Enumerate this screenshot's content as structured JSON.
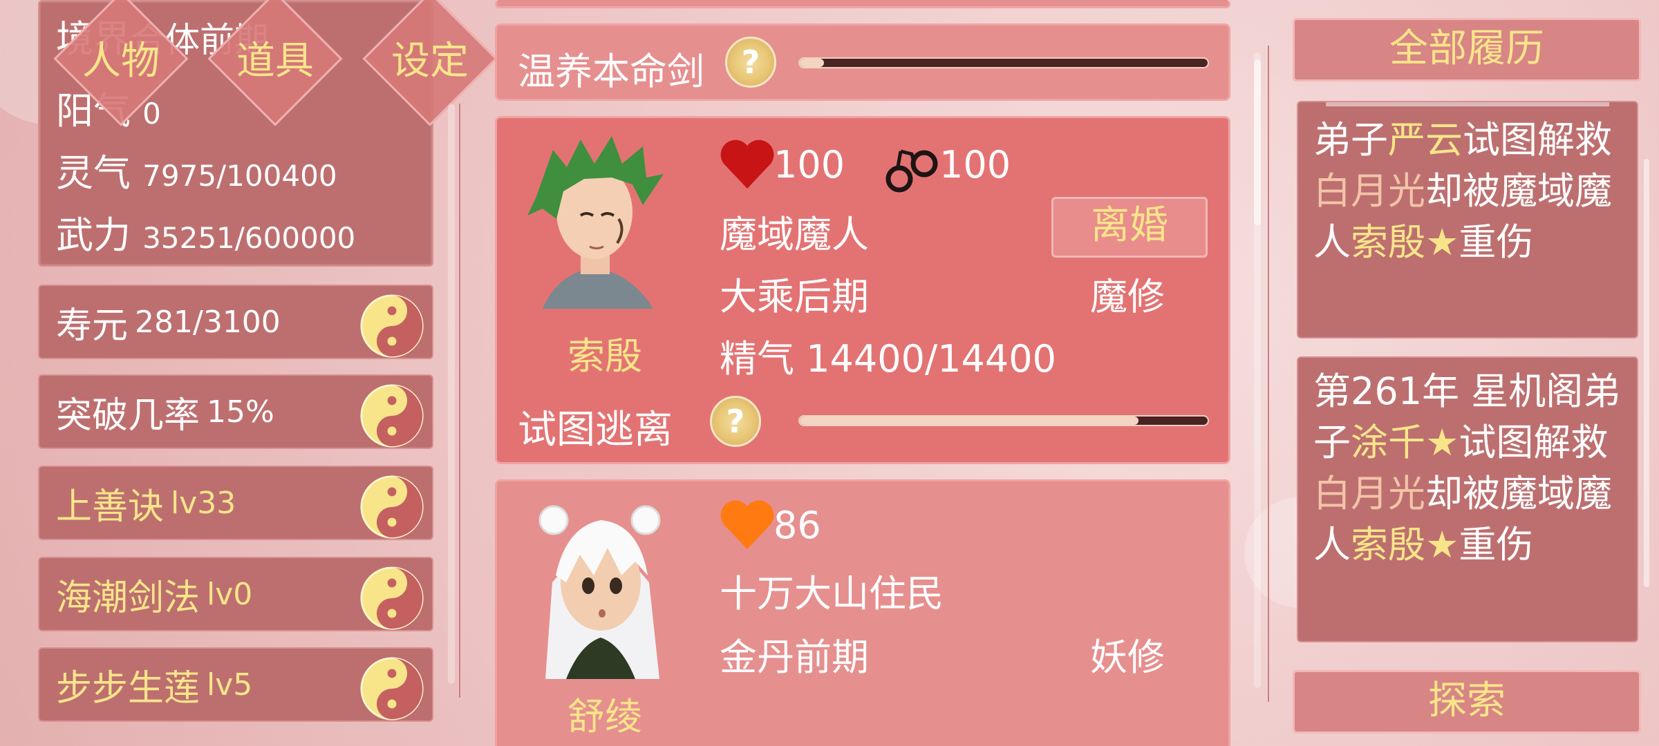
{
  "nav": {
    "tabs": [
      {
        "label": "人物"
      },
      {
        "label": "道具"
      },
      {
        "label": "设定"
      }
    ]
  },
  "stats": {
    "realm_label": "境界",
    "realm_value": "合体前期",
    "yang_label": "阳气",
    "yang_value": "0",
    "lingqi_label": "灵气",
    "lingqi_value": "7975/100400",
    "wuli_label": "武力",
    "wuli_value": "35251/600000"
  },
  "attributes": [
    {
      "label": "寿元",
      "value": "281/3100",
      "highlight": false
    },
    {
      "label": "突破几率",
      "value": "15%",
      "highlight": false
    },
    {
      "label": "上善诀",
      "value": "lv33",
      "highlight": true
    },
    {
      "label": "海潮剑法",
      "value": "lv0",
      "highlight": true
    },
    {
      "label": "步步生莲",
      "value": "lv5",
      "highlight": true
    }
  ],
  "cultivation": {
    "label": "温养本命剑",
    "progress": 0.06
  },
  "characters": [
    {
      "name": "索殷",
      "health": "100",
      "health_color": "#c81414",
      "bond": "100",
      "faction": "魔域魔人",
      "realm": "大乘后期",
      "type": "魔修",
      "essence_label": "精气",
      "essence": "14400/14400",
      "action_button": "离婚",
      "status_label": "试图逃离",
      "status_progress": 0.83
    },
    {
      "name": "舒绫",
      "health": "86",
      "health_color": "#ff7a10",
      "faction": "十万大山住民",
      "realm": "金丹前期",
      "type": "妖修"
    }
  ],
  "history": {
    "header_button": "全部履历",
    "entries": [
      {
        "segments": [
          {
            "t": "弟子",
            "h": false
          },
          {
            "t": "严云",
            "h": true
          },
          {
            "t": "试图解救",
            "h": false
          },
          {
            "t": "白月光",
            "h": true
          },
          {
            "t": "却被魔域魔人",
            "h": false
          },
          {
            "t": "索殷★",
            "h": true
          },
          {
            "t": "重伤",
            "h": false
          }
        ]
      },
      {
        "segments": [
          {
            "t": "第261年 星机阁弟子",
            "h": false
          },
          {
            "t": "涂千★",
            "h": true
          },
          {
            "t": "试图解救",
            "h": false
          },
          {
            "t": "白月光",
            "h": true
          },
          {
            "t": "却被魔域魔人",
            "h": false
          },
          {
            "t": "索殷★",
            "h": true
          },
          {
            "t": "重伤",
            "h": false
          }
        ]
      }
    ],
    "explore_button": "探索"
  },
  "colors": {
    "gold": "#f8e58a",
    "panel": "#bd6f6f",
    "card": "#e37373"
  }
}
